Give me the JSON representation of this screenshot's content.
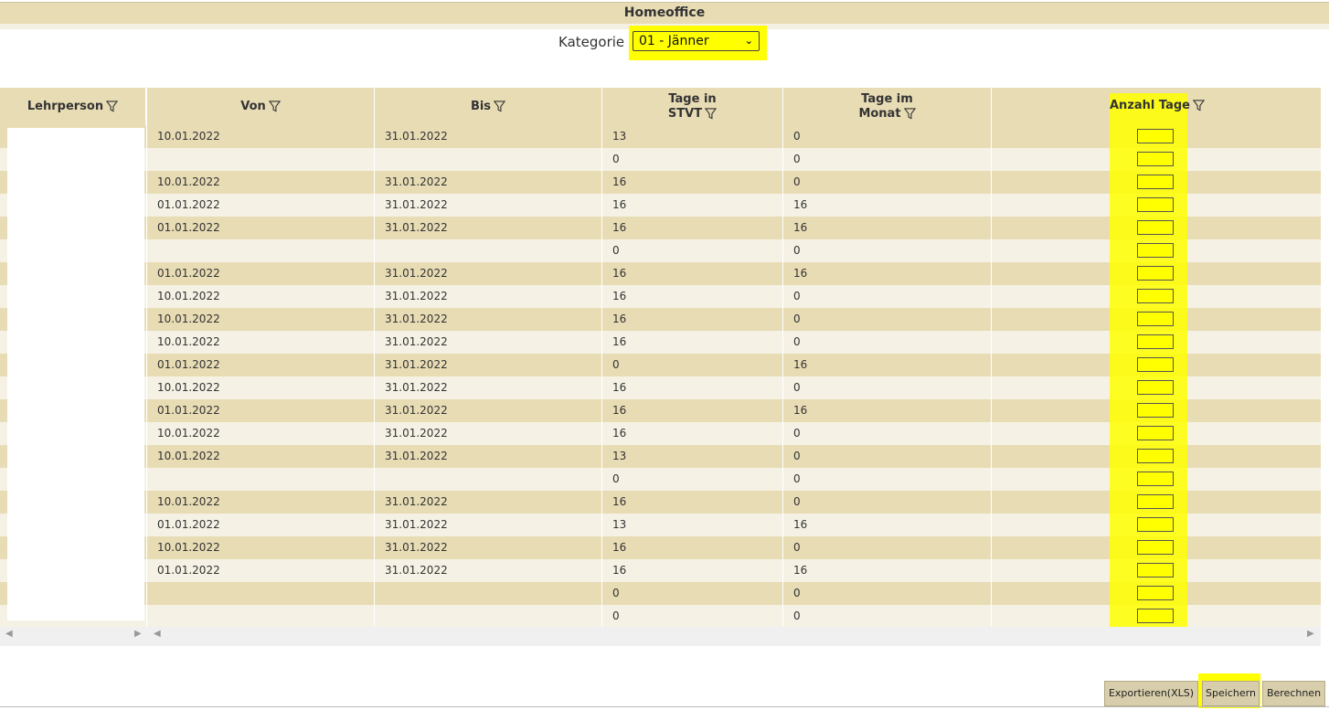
{
  "title": "Homeoffice",
  "kategorie": {
    "label": "Kategorie",
    "selected": "01 - Jänner"
  },
  "columns": {
    "lehrperson": "Lehrperson",
    "von": "Von",
    "bis": "Bis",
    "tage_stvt_line1": "Tage in",
    "tage_stvt_line2": "STVT",
    "tage_monat_line1": "Tage im",
    "tage_monat_line2": "Monat",
    "anzahl_tage": "Anzahl Tage"
  },
  "rows": [
    {
      "von": "10.01.2022",
      "bis": "31.01.2022",
      "stvt": "13",
      "monat": "0"
    },
    {
      "von": "",
      "bis": "",
      "stvt": "0",
      "monat": "0"
    },
    {
      "von": "10.01.2022",
      "bis": "31.01.2022",
      "stvt": "16",
      "monat": "0"
    },
    {
      "von": "01.01.2022",
      "bis": "31.01.2022",
      "stvt": "16",
      "monat": "16"
    },
    {
      "von": "01.01.2022",
      "bis": "31.01.2022",
      "stvt": "16",
      "monat": "16"
    },
    {
      "von": "",
      "bis": "",
      "stvt": "0",
      "monat": "0"
    },
    {
      "von": "01.01.2022",
      "bis": "31.01.2022",
      "stvt": "16",
      "monat": "16"
    },
    {
      "von": "10.01.2022",
      "bis": "31.01.2022",
      "stvt": "16",
      "monat": "0"
    },
    {
      "von": "10.01.2022",
      "bis": "31.01.2022",
      "stvt": "16",
      "monat": "0"
    },
    {
      "von": "10.01.2022",
      "bis": "31.01.2022",
      "stvt": "16",
      "monat": "0"
    },
    {
      "von": "01.01.2022",
      "bis": "31.01.2022",
      "stvt": "0",
      "monat": "16"
    },
    {
      "von": "10.01.2022",
      "bis": "31.01.2022",
      "stvt": "16",
      "monat": "0"
    },
    {
      "von": "01.01.2022",
      "bis": "31.01.2022",
      "stvt": "16",
      "monat": "16"
    },
    {
      "von": "10.01.2022",
      "bis": "31.01.2022",
      "stvt": "16",
      "monat": "0"
    },
    {
      "von": "10.01.2022",
      "bis": "31.01.2022",
      "stvt": "13",
      "monat": "0"
    },
    {
      "von": "",
      "bis": "",
      "stvt": "0",
      "monat": "0"
    },
    {
      "von": "10.01.2022",
      "bis": "31.01.2022",
      "stvt": "16",
      "monat": "0"
    },
    {
      "von": "01.01.2022",
      "bis": "31.01.2022",
      "stvt": "13",
      "monat": "16"
    },
    {
      "von": "10.01.2022",
      "bis": "31.01.2022",
      "stvt": "16",
      "monat": "0"
    },
    {
      "von": "01.01.2022",
      "bis": "31.01.2022",
      "stvt": "16",
      "monat": "16"
    },
    {
      "von": "",
      "bis": "",
      "stvt": "0",
      "monat": "0"
    },
    {
      "von": "",
      "bis": "",
      "stvt": "0",
      "monat": "0"
    }
  ],
  "buttons": {
    "export": "Exportieren(XLS)",
    "save": "Speichern",
    "calc": "Berechnen"
  },
  "colors": {
    "header_bg": "#e8dcb5",
    "row_alt_bg": "#f5f2e5",
    "highlight": "#ffff00"
  }
}
